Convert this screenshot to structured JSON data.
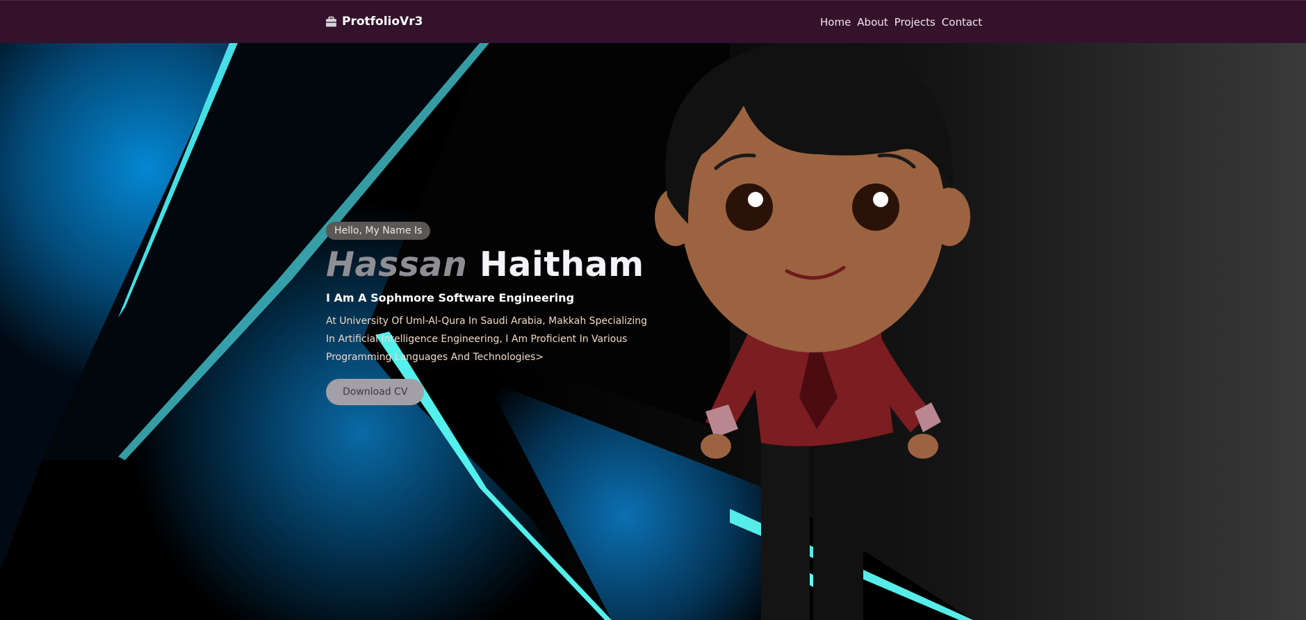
{
  "navbar": {
    "brand": "ProtfolioVr3",
    "links": [
      "Home",
      "About",
      "Projects",
      "Contact"
    ]
  },
  "hero": {
    "greeting": "Hello, My Name Is",
    "first_name": "Hassan",
    "last_name": "Haitham",
    "tagline": "I Am A Sophmore Software Engineering",
    "description": "At University Of Uml-Al-Qura In Saudi Arabia, Makkah Specializing In Artificial Intelligence Engineering, I Am Proficient In Various Programming Languages And Technologies>",
    "cta": "Download CV"
  },
  "colors": {
    "navbar_bg": "#35122b",
    "accent_blue": "#0a84d0",
    "accent_cyan": "#4be3e8",
    "shirt": "#7d1c20",
    "skin": "#9c6340"
  },
  "icons": {
    "brand": "briefcase-icon"
  }
}
